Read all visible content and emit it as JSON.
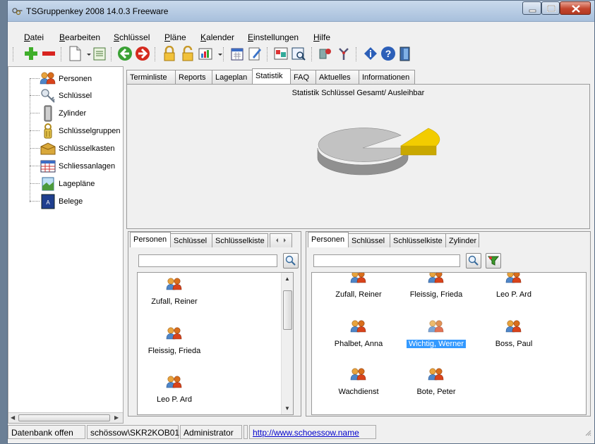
{
  "window": {
    "title": "TSGruppenkey 2008 14.0.3 Freeware"
  },
  "menu": {
    "items": [
      {
        "first": "D",
        "rest": "atei"
      },
      {
        "first": "B",
        "rest": "earbeiten"
      },
      {
        "first": "S",
        "rest": "chlüssel"
      },
      {
        "first": "P",
        "rest": "läne"
      },
      {
        "first": "K",
        "rest": "alender"
      },
      {
        "first": "E",
        "rest": "instellungen"
      },
      {
        "first": "H",
        "rest": "ilfe"
      }
    ]
  },
  "tree": {
    "items": [
      {
        "label": "Personen",
        "icon": "persons-icon"
      },
      {
        "label": "Schlüssel",
        "icon": "key-icon"
      },
      {
        "label": "Zylinder",
        "icon": "cylinder-icon"
      },
      {
        "label": "Schlüsselgruppen",
        "icon": "key-group-icon"
      },
      {
        "label": "Schlüsselkasten",
        "icon": "key-box-icon"
      },
      {
        "label": "Schliessanlagen",
        "icon": "locking-system-icon"
      },
      {
        "label": "Lagepläne",
        "icon": "site-plan-icon"
      },
      {
        "label": "Belege",
        "icon": "document-icon"
      }
    ]
  },
  "main_tabs": [
    "Terminliste",
    "Reports",
    "Lageplan",
    "Statistik",
    "FAQ",
    "Aktuelles",
    "Informationen"
  ],
  "main_active_tab": "Statistik",
  "statistik": {
    "title": "Statistik Schlüssel Gesamt/ Ausleihbar",
    "colors": {
      "gesamt": "#b8b8b8",
      "ausleihbar": "#f2cc00"
    }
  },
  "left_panel": {
    "tabs": [
      "Personen",
      "Schlüssel",
      "Schlüsselkiste"
    ],
    "search_value": "",
    "persons": [
      "Zufall, Reiner",
      "Fleissig, Frieda",
      "Leo P. Ard"
    ]
  },
  "right_panel": {
    "tabs": [
      "Personen",
      "Schlüssel",
      "Schlüsselkiste",
      "Zylinder"
    ],
    "search_value": "",
    "persons": [
      "Zufall, Reiner",
      "Fleissig, Frieda",
      "Leo P. Ard",
      "Phalbet, Anna",
      "Wichtig, Werner",
      "Boss, Paul",
      "Wachdienst",
      "Bote, Peter"
    ],
    "selected": "Wichtig, Werner"
  },
  "statusbar": {
    "db": "Datenbank offen",
    "server": "schössow\\SKR2KOB01",
    "user": "Administrator",
    "link": "http://www.schoessow.name"
  }
}
